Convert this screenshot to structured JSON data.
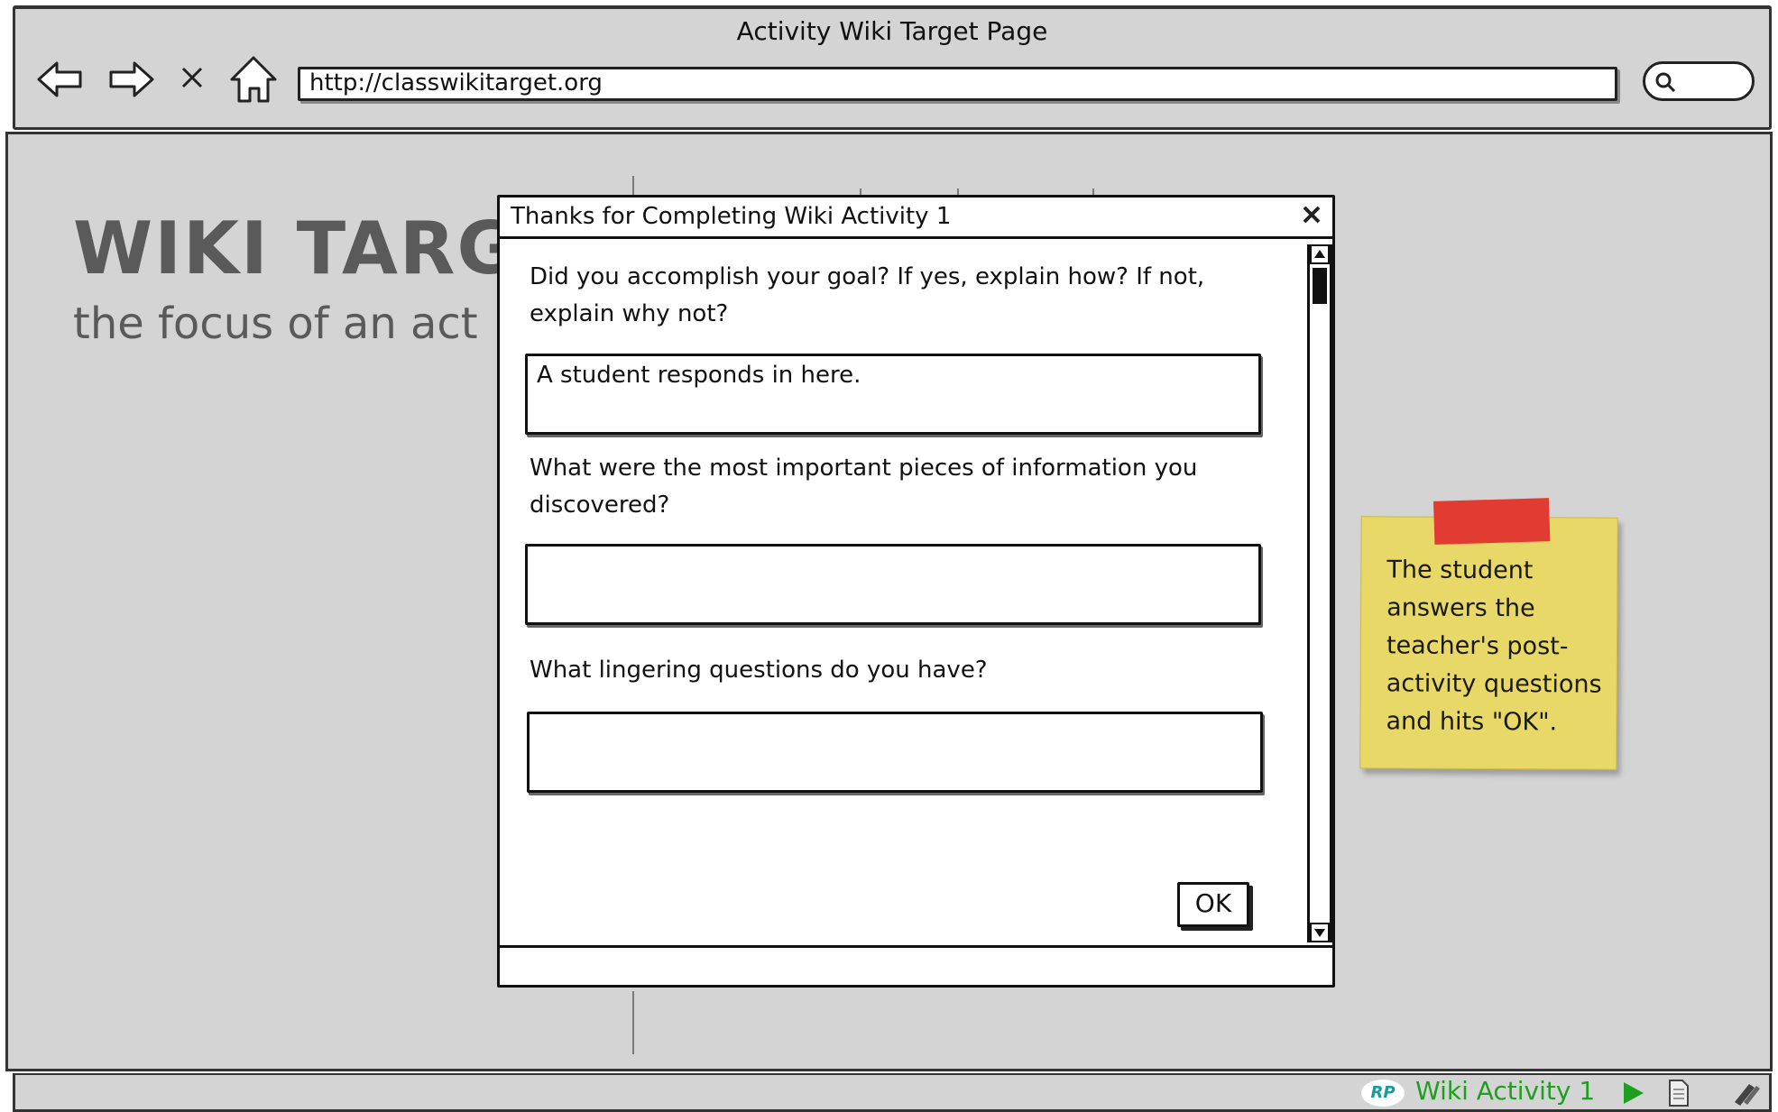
{
  "window": {
    "title": "Activity Wiki Target Page",
    "url": "http://classwikitarget.org"
  },
  "nav_icons": [
    "back-arrow-icon",
    "forward-arrow-icon",
    "stop-icon",
    "home-icon",
    "search-icon"
  ],
  "page": {
    "heading": "WIKI TARG",
    "subheading": "the focus of an act"
  },
  "dialog": {
    "title": "Thanks for Completing Wiki Activity 1",
    "questions": [
      {
        "line1": "Did you accomplish your goal?  If yes, explain how?  If not,",
        "line2": "explain why not?",
        "answer": "A student responds in here."
      },
      {
        "line1": "What were the most important pieces of information you",
        "line2": "discovered?",
        "answer": ""
      },
      {
        "line1": "What lingering questions do you have?",
        "line2": "",
        "answer": ""
      }
    ],
    "ok_label": "OK"
  },
  "sticky_note": {
    "lines": [
      "The student",
      "answers the",
      "teacher's post-",
      "activity questions",
      "and hits \"OK\"."
    ]
  },
  "status_bar": {
    "logo": "RP",
    "label": "Wiki Activity 1"
  },
  "colors": {
    "chrome": "#d4d4d4",
    "sticky": "#e8d868",
    "tape": "#e23c32",
    "status_green": "#1f9f1f"
  }
}
